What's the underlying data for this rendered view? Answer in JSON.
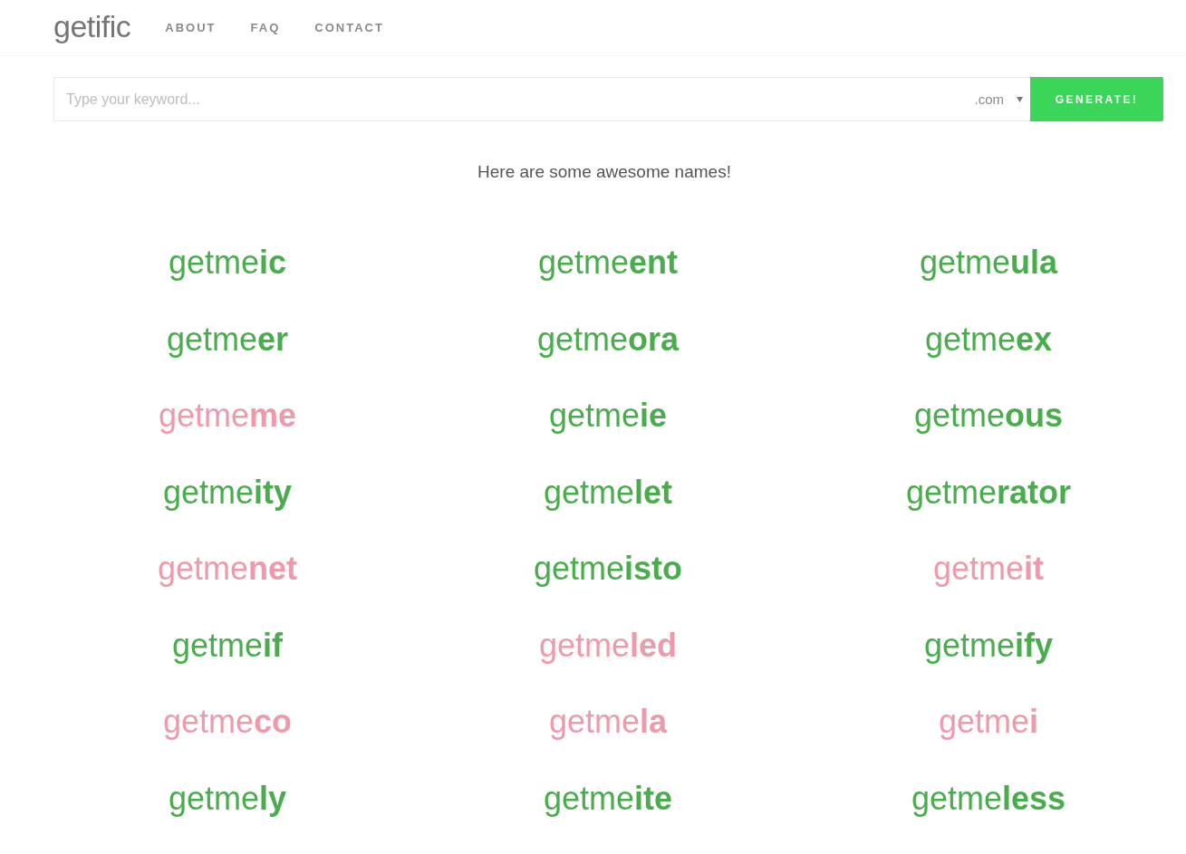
{
  "header": {
    "logo": "getific",
    "nav": [
      "ABOUT",
      "FAQ",
      "CONTACT"
    ]
  },
  "search": {
    "placeholder": "Type your keyword...",
    "extension": ".com",
    "button": "GENERATE!"
  },
  "heading": "Here are some awesome names!",
  "names": [
    {
      "text": "getme**ic**",
      "available": true
    },
    {
      "text": "getme**ent**",
      "available": true
    },
    {
      "text": "getme**ula**",
      "available": true
    },
    {
      "text": "getme**er**",
      "available": true
    },
    {
      "text": "getme**ora**",
      "available": true
    },
    {
      "text": "getme**ex**",
      "available": true
    },
    {
      "text": "getme**me**",
      "available": false
    },
    {
      "text": "getme**ie**",
      "available": true
    },
    {
      "text": "getme**ous**",
      "available": true
    },
    {
      "text": "getme**ity**",
      "available": true
    },
    {
      "text": "getme**let**",
      "available": true
    },
    {
      "text": "getme**rator**",
      "available": true
    },
    {
      "text": "getme**net**",
      "available": false
    },
    {
      "text": "getme**isto**",
      "available": true
    },
    {
      "text": "getme**it**",
      "available": false
    },
    {
      "text": "getme**if**",
      "available": true
    },
    {
      "text": "getme**led**",
      "available": false
    },
    {
      "text": "getme**ify**",
      "available": true
    },
    {
      "text": "getme**co**",
      "available": false
    },
    {
      "text": "getme**la**",
      "available": false
    },
    {
      "text": "getme**i**",
      "available": false
    },
    {
      "text": "getme**ly**",
      "available": true
    },
    {
      "text": "getme**ite**",
      "available": true
    },
    {
      "text": "getme**less**",
      "available": true
    }
  ]
}
